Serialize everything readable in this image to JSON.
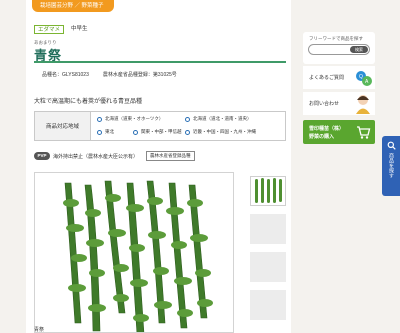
{
  "breadcrumb": "栽培園芸分野 ／ 野菜種子",
  "tags": [
    "エダマメ",
    "中早生"
  ],
  "product": {
    "kana": "あおまりり",
    "name": "青祭",
    "item_no": "品種名：GLYS81023",
    "registration": "農林水産省品種登録：第31025号",
    "catch": "大粒で高温期にも着莢が優れる青豆品種"
  },
  "area": {
    "label": "商品対応地域",
    "regions": [
      "北海道（道東・オホーツク）",
      "北海道（道北・道南・道央）",
      "東北",
      "関東・中部・甲信越",
      "近畿・中国・四国・九州・沖縄"
    ]
  },
  "pvp": {
    "icon": "PVP",
    "text": "海外持出禁止（農林水産大臣公示有）",
    "badge": "農林水産省登録品種"
  },
  "photo_caption": "青祭",
  "sidebar": {
    "search_title": "フリーワードで商品を探す",
    "search_button": "検索",
    "search_placeholder": "",
    "faq": "よくあるご質問",
    "contact": "お問い合わせ",
    "shop_line1": "雪印種苗（株）",
    "shop_line2": "野菜の購入"
  },
  "float_search": "商品を探す",
  "colors": {
    "accent_orange": "#f29a1f",
    "brand_green": "#3f9a68",
    "shop_green": "#5aa62f",
    "float_blue": "#2f62b5"
  }
}
